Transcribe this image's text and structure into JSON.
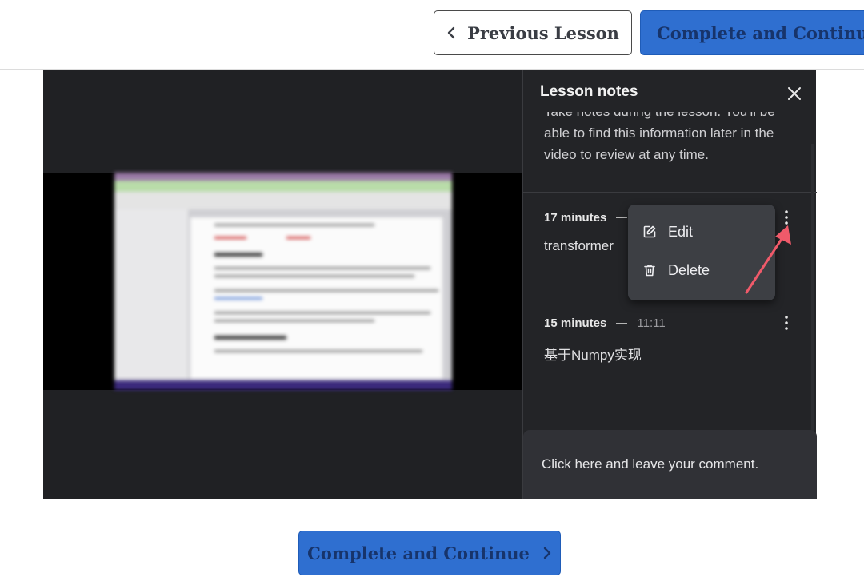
{
  "nav": {
    "prev_label": "Previous Lesson",
    "complete_label": "Complete and Continue"
  },
  "notes_panel": {
    "title": "Lesson notes",
    "intro": "Take notes during the lesson. You'll be able to find this information later in the video to review at any time.",
    "notes": [
      {
        "time_label": "17 minutes",
        "text": "transformer"
      },
      {
        "time_label": "15 minutes",
        "timestamp": "11:11",
        "text": "基于Numpy实现"
      }
    ],
    "context_menu": {
      "items": [
        {
          "label": "Edit",
          "icon": "edit-icon"
        },
        {
          "label": "Delete",
          "icon": "trash-icon"
        }
      ]
    },
    "comment_placeholder": "Click here and leave your comment."
  },
  "footer": {
    "complete_label": "Complete and Continue"
  },
  "colors": {
    "primary_button": "#2f6fd0",
    "primary_button_text": "#17346b",
    "panel_bg": "#232427",
    "menu_bg": "#3d3f44",
    "annotation_arrow": "#f05a6a"
  }
}
